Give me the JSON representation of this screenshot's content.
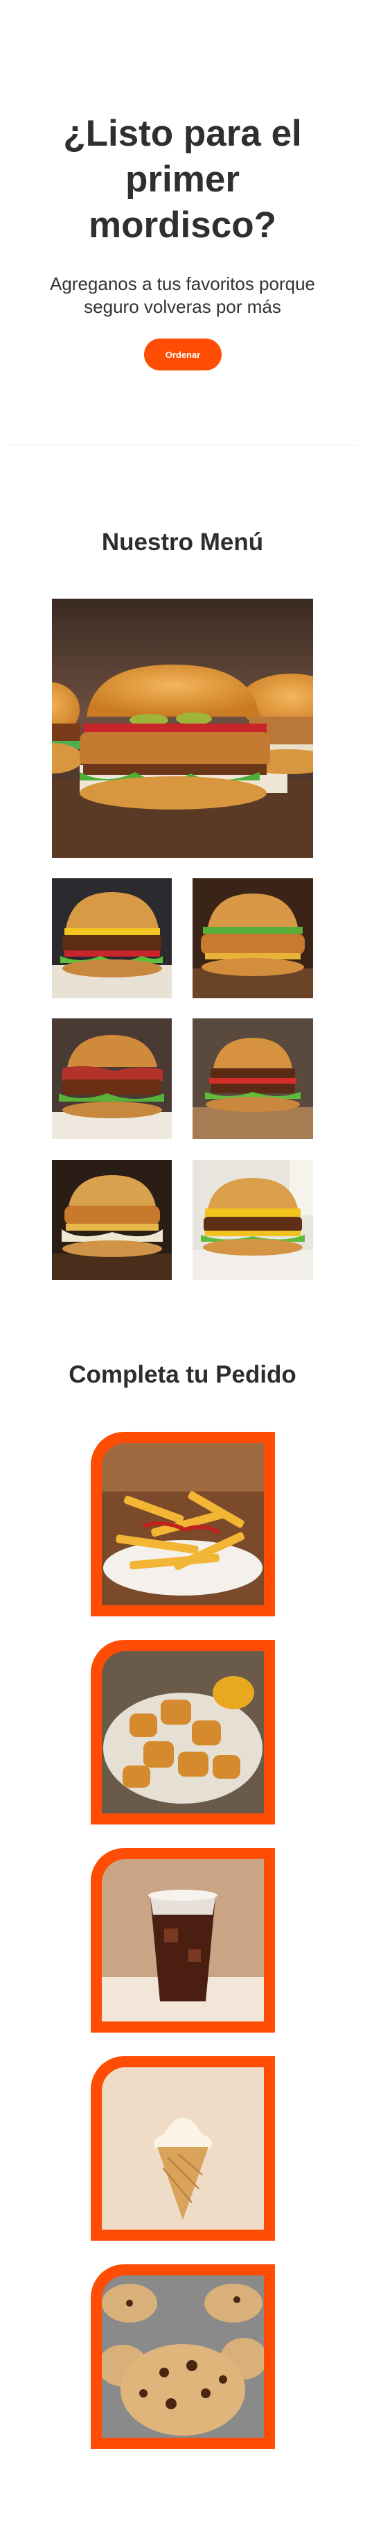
{
  "hero": {
    "title": "¿Listo para el primer mordisco?",
    "subtitle": "Agreganos a tus favoritos porque seguro volveras por más",
    "order_button": "Ordenar"
  },
  "menu": {
    "title": "Nuestro Menú",
    "featured_image": "burger-platter-photo",
    "gallery": [
      "classic-cheeseburger-photo",
      "crispy-chicken-burger-photo",
      "bacon-burger-photo",
      "double-burger-photo",
      "coleslaw-chicken-burger-photo",
      "cheese-burger-with-fries-photo"
    ]
  },
  "sides": {
    "title": "Completa tu Pedido",
    "items": [
      "french-fries-photo",
      "fried-nuggets-photo",
      "iced-soda-photo",
      "ice-cream-cone-photo",
      "chocolate-chip-cookies-photo"
    ]
  },
  "colors": {
    "accent": "#ff4d06",
    "text": "#2d2d2d",
    "background": "#ffffff"
  }
}
